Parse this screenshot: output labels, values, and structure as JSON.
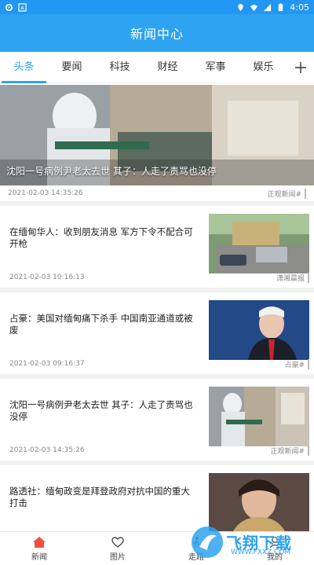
{
  "status_bar": {
    "time": "4:05",
    "left_icons": [
      "gear-icon",
      "a-icon"
    ],
    "right_icons": [
      "location-icon",
      "wifi-icon",
      "signal-icon",
      "battery-icon"
    ]
  },
  "app_bar": {
    "title": "新闻中心"
  },
  "tabs": {
    "items": [
      "头条",
      "要闻",
      "科技",
      "财经",
      "军事",
      "娱乐"
    ],
    "active": 0,
    "add_icon": "plus-icon"
  },
  "hero": {
    "title": "沈阳一号病例尹老太去世 其子：人走了责骂也没停",
    "time": "2021-02-03 14:35:26",
    "source": "正观新闻#"
  },
  "items": [
    {
      "title": "在缅甸华人：收到朋友消息 军方下令不配合可开枪",
      "time": "2021-02-03 10:16:13",
      "source": "潇湘晨报"
    },
    {
      "title": "占豪：美国对缅甸痛下杀手 中国南亚通道或被废",
      "time": "2021-02-03 09:16:37",
      "source": "占豪#"
    },
    {
      "title": "沈阳一号病例尹老太去世 其子：人走了责骂也没停",
      "time": "2021-02-03 14:35:26",
      "source": "正观新闻#"
    },
    {
      "title": "路透社：缅甸政变是拜登政府对抗中国的重大打击",
      "time": "",
      "source": ""
    }
  ],
  "bottom_nav": [
    {
      "label": "新闻",
      "icon": "home-icon",
      "active": true
    },
    {
      "label": "图片",
      "icon": "heart-icon",
      "active": false
    },
    {
      "label": "走路",
      "icon": "walk-icon",
      "active": false
    },
    {
      "label": "我的",
      "icon": "user-icon",
      "active": false
    }
  ],
  "watermark": {
    "text": "飞翔下载",
    "sub": "WWW.FXXZ.COM"
  },
  "colors": {
    "primary": "#2ea3f2",
    "status_bar": "#2196f3",
    "active_nav": "#f0503c"
  }
}
